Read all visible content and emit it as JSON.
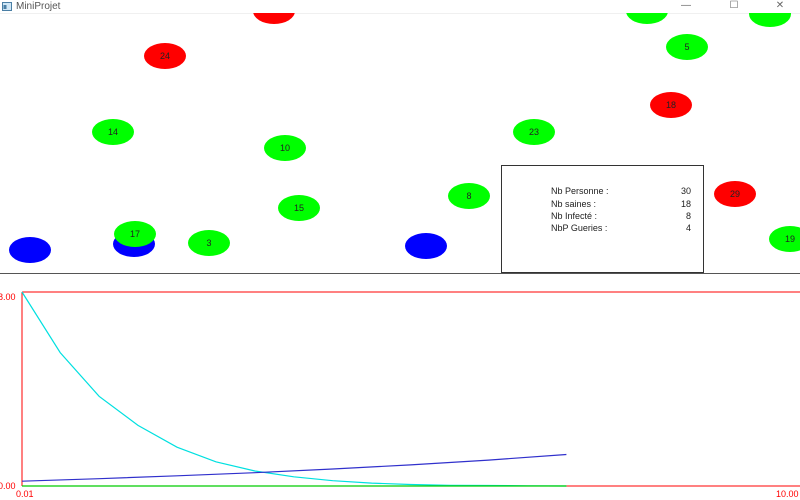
{
  "window": {
    "title": "MiniProjet",
    "minimize": "—",
    "maximize": "☐",
    "close": "✕"
  },
  "colors": {
    "sain": "#00ff00",
    "infecte": "#ff0000",
    "gueri": "#0000ff",
    "axis": "#ff0000",
    "curve_sains": "#00e0e0",
    "curve_gueris": "#3030cc",
    "curve_infectes": "#00cc00"
  },
  "people": [
    {
      "label": "",
      "status": "infecte"
    },
    {
      "label": "",
      "status": "sain"
    },
    {
      "label": "",
      "status": "sain"
    },
    {
      "label": "24",
      "status": "infecte"
    },
    {
      "label": "5",
      "status": "sain"
    },
    {
      "label": "18",
      "status": "infecte"
    },
    {
      "label": "14",
      "status": "sain"
    },
    {
      "label": "10",
      "status": "sain"
    },
    {
      "label": "23",
      "status": "sain"
    },
    {
      "label": "8",
      "status": "sain"
    },
    {
      "label": "29",
      "status": "infecte"
    },
    {
      "label": "15",
      "status": "sain"
    },
    {
      "label": "",
      "status": "gueri"
    },
    {
      "label": "17",
      "status": "sain"
    },
    {
      "label": "3",
      "status": "sain"
    },
    {
      "label": "",
      "status": "gueri"
    },
    {
      "label": "",
      "status": "gueri"
    },
    {
      "label": "19",
      "status": "sain"
    }
  ],
  "stats": [
    {
      "label": "Nb Personne :",
      "value": "30"
    },
    {
      "label": "Nb saines :",
      "value": "18"
    },
    {
      "label": "Nb Infecté :",
      "value": "8"
    },
    {
      "label": "NbP Gueries :",
      "value": "4"
    }
  ],
  "chart_data": {
    "type": "line",
    "y_tick_top": "8.00",
    "y_tick_bottom": "0.00",
    "x_tick_left": "0.01",
    "x_tick_right": "10.00",
    "xlim": [
      0.01,
      10.0
    ],
    "ylim": [
      0.0,
      8.0
    ],
    "series": [
      {
        "color_key": "curve_sains",
        "x": [
          0.01,
          0.5,
          1.0,
          1.5,
          2.0,
          2.5,
          3.0,
          3.5,
          4.0,
          4.5,
          5.0,
          5.5,
          6.0,
          6.5,
          7.0
        ],
        "y": [
          8.0,
          5.5,
          3.7,
          2.5,
          1.6,
          1.0,
          0.62,
          0.38,
          0.22,
          0.12,
          0.06,
          0.03,
          0.02,
          0.01,
          0.0
        ]
      },
      {
        "color_key": "curve_gueris",
        "x": [
          0.01,
          1.0,
          2.0,
          3.0,
          4.0,
          5.0,
          6.0,
          7.0
        ],
        "y": [
          0.2,
          0.3,
          0.42,
          0.55,
          0.7,
          0.87,
          1.07,
          1.3
        ]
      },
      {
        "color_key": "curve_infectes",
        "x": [
          0.01,
          2.0,
          4.0,
          6.0,
          7.0
        ],
        "y": [
          0.0,
          0.0,
          0.0,
          0.0,
          0.0
        ]
      }
    ]
  }
}
